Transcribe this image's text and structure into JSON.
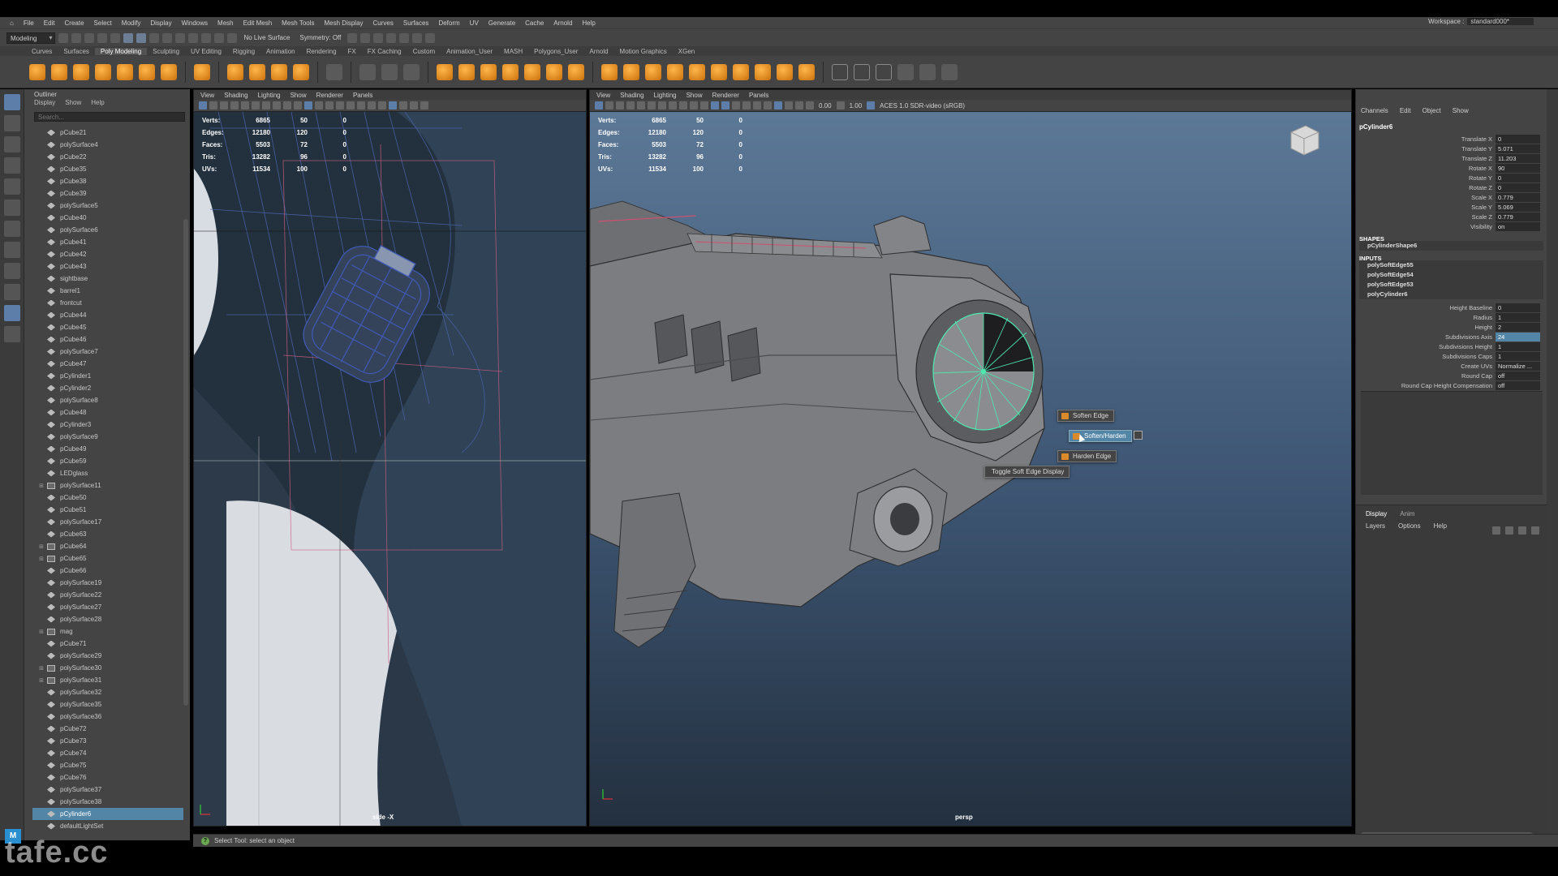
{
  "menubar": {
    "items": [
      "File",
      "Edit",
      "Create",
      "Select",
      "Modify",
      "Display",
      "Windows",
      "Mesh",
      "Edit Mesh",
      "Mesh Tools",
      "Mesh Display",
      "Curves",
      "Surfaces",
      "Deform",
      "UV",
      "Generate",
      "Cache",
      "Arnold",
      "Help"
    ],
    "workspace_label": "Workspace :",
    "workspace_value": "standard000*"
  },
  "statusline": {
    "mode": "Modeling",
    "live_surface": "No Live Surface",
    "symmetry": "Symmetry: Off"
  },
  "shelf_tabs": [
    "Curves",
    "Surfaces",
    "Poly Modeling",
    "Sculpting",
    "UV Editing",
    "Rigging",
    "Animation",
    "Rendering",
    "FX",
    "FX Caching",
    "Custom",
    "Animation_User",
    "MASH",
    "Polygons_User",
    "Arnold",
    "Motion Graphics",
    "XGen"
  ],
  "shelf_active": "Poly Modeling",
  "outliner": {
    "title": "Outliner",
    "menu": [
      "Display",
      "Show",
      "Help"
    ],
    "search_placeholder": "Search...",
    "items": [
      {
        "name": "pCube21",
        "group": false
      },
      {
        "name": "polySurface4",
        "group": false
      },
      {
        "name": "pCube22",
        "group": false
      },
      {
        "name": "pCube35",
        "group": false
      },
      {
        "name": "pCube38",
        "group": false
      },
      {
        "name": "pCube39",
        "group": false
      },
      {
        "name": "polySurface5",
        "group": false
      },
      {
        "name": "pCube40",
        "group": false
      },
      {
        "name": "polySurface6",
        "group": false
      },
      {
        "name": "pCube41",
        "group": false
      },
      {
        "name": "pCube42",
        "group": false
      },
      {
        "name": "pCube43",
        "group": false
      },
      {
        "name": "sightbase",
        "group": false
      },
      {
        "name": "barrel1",
        "group": false
      },
      {
        "name": "frontcut",
        "group": false
      },
      {
        "name": "pCube44",
        "group": false
      },
      {
        "name": "pCube45",
        "group": false
      },
      {
        "name": "pCube46",
        "group": false
      },
      {
        "name": "polySurface7",
        "group": false
      },
      {
        "name": "pCube47",
        "group": false
      },
      {
        "name": "pCylinder1",
        "group": false
      },
      {
        "name": "pCylinder2",
        "group": false
      },
      {
        "name": "polySurface8",
        "group": false
      },
      {
        "name": "pCube48",
        "group": false
      },
      {
        "name": "pCylinder3",
        "group": false
      },
      {
        "name": "polySurface9",
        "group": false
      },
      {
        "name": "pCube49",
        "group": false
      },
      {
        "name": "pCube59",
        "group": false
      },
      {
        "name": "LEDglass",
        "group": false
      },
      {
        "name": "polySurface11",
        "group": true
      },
      {
        "name": "pCube50",
        "group": false
      },
      {
        "name": "pCube51",
        "group": false
      },
      {
        "name": "polySurface17",
        "group": false
      },
      {
        "name": "pCube63",
        "group": false
      },
      {
        "name": "pCube64",
        "group": true
      },
      {
        "name": "pCube65",
        "group": true
      },
      {
        "name": "pCube66",
        "group": false
      },
      {
        "name": "polySurface19",
        "group": false
      },
      {
        "name": "polySurface22",
        "group": false
      },
      {
        "name": "polySurface27",
        "group": false
      },
      {
        "name": "polySurface28",
        "group": false
      },
      {
        "name": "mag",
        "group": true
      },
      {
        "name": "pCube71",
        "group": false
      },
      {
        "name": "polySurface29",
        "group": false
      },
      {
        "name": "polySurface30",
        "group": true
      },
      {
        "name": "polySurface31",
        "group": true
      },
      {
        "name": "polySurface32",
        "group": false
      },
      {
        "name": "polySurface35",
        "group": false
      },
      {
        "name": "polySurface36",
        "group": false
      },
      {
        "name": "pCube72",
        "group": false
      },
      {
        "name": "pCube73",
        "group": false
      },
      {
        "name": "pCube74",
        "group": false
      },
      {
        "name": "pCube75",
        "group": false
      },
      {
        "name": "pCube76",
        "group": false
      },
      {
        "name": "polySurface37",
        "group": false
      },
      {
        "name": "polySurface38",
        "group": false
      },
      {
        "name": "pCylinder6",
        "group": false,
        "selected": true
      },
      {
        "name": "defaultLightSet",
        "group": false
      }
    ]
  },
  "viewport_menu": [
    "View",
    "Shading",
    "Lighting",
    "Show",
    "Renderer",
    "Panels"
  ],
  "viewport_tools": {
    "exposure": "0.00",
    "gamma": "1.00",
    "color_space": "ACES 1.0 SDR-video (sRGB)"
  },
  "hud": {
    "rows": [
      {
        "label": "Verts:",
        "a": "6865",
        "b": "50",
        "c": "0"
      },
      {
        "label": "Edges:",
        "a": "12180",
        "b": "120",
        "c": "0"
      },
      {
        "label": "Faces:",
        "a": "5503",
        "b": "72",
        "c": "0"
      },
      {
        "label": "Tris:",
        "a": "13282",
        "b": "96",
        "c": "0"
      },
      {
        "label": "UVs:",
        "a": "11534",
        "b": "100",
        "c": "0"
      }
    ]
  },
  "viewport_left": {
    "camera": "side -X"
  },
  "viewport_right": {
    "camera": "persp"
  },
  "marking_menu": {
    "soften": "Soften Edge",
    "soften_harden": "Soften/Harden",
    "harden": "Harden Edge",
    "toggle": "Toggle Soft Edge Display"
  },
  "channel_box": {
    "menu": [
      "Channels",
      "Edit",
      "Object",
      "Show"
    ],
    "object": "pCylinder6",
    "transforms": [
      {
        "name": "Translate X",
        "value": "0"
      },
      {
        "name": "Translate Y",
        "value": "5.071"
      },
      {
        "name": "Translate Z",
        "value": "11.203"
      },
      {
        "name": "Rotate X",
        "value": "90"
      },
      {
        "name": "Rotate Y",
        "value": "0"
      },
      {
        "name": "Rotate Z",
        "value": "0"
      },
      {
        "name": "Scale X",
        "value": "0.779"
      },
      {
        "name": "Scale Y",
        "value": "5.069"
      },
      {
        "name": "Scale Z",
        "value": "0.779"
      },
      {
        "name": "Visibility",
        "value": "on"
      }
    ],
    "shapes_label": "SHAPES",
    "shape": "pCylinderShape6",
    "inputs_label": "INPUTS",
    "inputs": [
      "polySoftEdge55",
      "polySoftEdge54",
      "polySoftEdge53",
      "polyCylinder6"
    ],
    "attrs": [
      {
        "name": "Height Baseline",
        "value": "0"
      },
      {
        "name": "Radius",
        "value": "1"
      },
      {
        "name": "Height",
        "value": "2"
      },
      {
        "name": "Subdivisions Axis",
        "value": "24",
        "highlight": true
      },
      {
        "name": "Subdivisions Height",
        "value": "1"
      },
      {
        "name": "Subdivisions Caps",
        "value": "1"
      },
      {
        "name": "Create UVs",
        "value": "Normalize ..."
      },
      {
        "name": "Round Cap",
        "value": "off"
      },
      {
        "name": "Round Cap Height Compensation",
        "value": "off"
      }
    ]
  },
  "layer_panel": {
    "tabs": [
      "Display",
      "Anim"
    ],
    "menu": [
      "Layers",
      "Options",
      "Help"
    ]
  },
  "help_line": "Select Tool: select an object",
  "watermark": "tafe.cc"
}
